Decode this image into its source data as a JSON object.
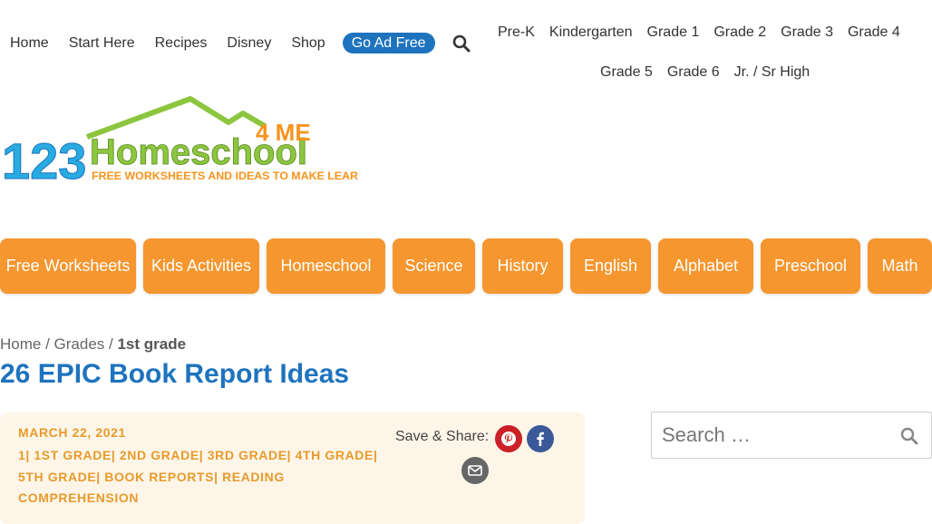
{
  "topnav": {
    "items": [
      "Home",
      "Start Here",
      "Recipes",
      "Disney",
      "Shop"
    ],
    "go_ad_free": "Go Ad Free"
  },
  "grades": {
    "row1": [
      "Pre-K",
      "Kindergarten",
      "Grade 1",
      "Grade 2",
      "Grade 3",
      "Grade 4"
    ],
    "row2": [
      "Grade 5",
      "Grade 6",
      "Jr. / Sr High"
    ]
  },
  "logo": {
    "main": "123Homeschool",
    "suffix": "4 ME",
    "tagline": "FREE WORKSHEETS AND IDEAS TO MAKE LEARNING FUN!"
  },
  "categories": [
    "Free Worksheets",
    "Kids Activities",
    "Homeschool",
    "Science",
    "History",
    "English",
    "Alphabet",
    "Preschool",
    "Math"
  ],
  "breadcrumb": {
    "home": "Home",
    "sep1": " / ",
    "grades": "Grades",
    "sep2": " / ",
    "current": "1st grade"
  },
  "title": "26 EPIC Book Report Ideas",
  "meta": {
    "date": "MARCH 22, 2021",
    "categories": "1| 1ST GRADE| 2ND GRADE| 3RD GRADE| 4TH GRADE| 5TH GRADE| BOOK REPORTS| READING COMPREHENSION",
    "share_label": "Save & Share:"
  },
  "search": {
    "placeholder": "Search …"
  },
  "colors": {
    "accent_blue": "#1e73be",
    "category_orange": "#f5962e",
    "meta_orange": "#e89a2c",
    "card_bg": "#fdf6e8"
  }
}
